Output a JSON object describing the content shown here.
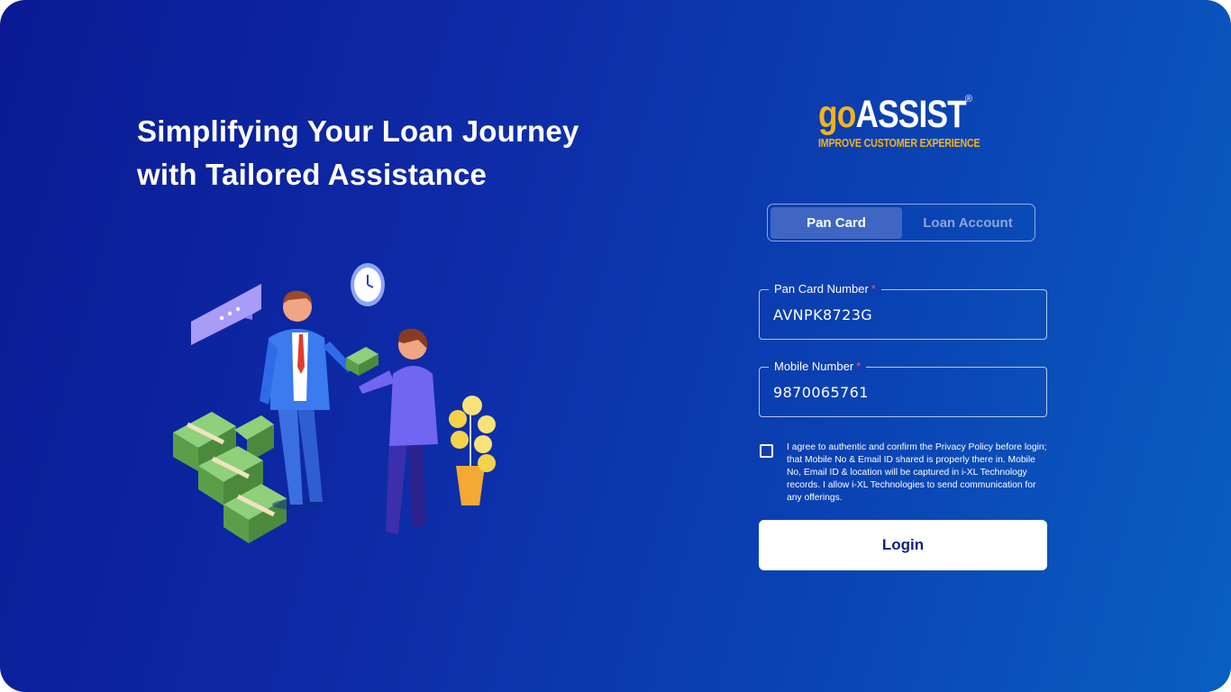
{
  "hero": {
    "title_line1": "Simplifying Your Loan Journey",
    "title_line2": "with Tailored Assistance"
  },
  "logo": {
    "brand_prefix": "go",
    "brand_main": "ASSIST",
    "registered_mark": "®",
    "tagline": "IMPROVE CUSTOMER EXPERIENCE"
  },
  "tabs": [
    {
      "label": "Pan Card",
      "active": true
    },
    {
      "label": "Loan Account",
      "active": false
    }
  ],
  "form": {
    "pan": {
      "label": "Pan Card Number",
      "required_mark": "*",
      "value": "AVNPK8723G"
    },
    "mobile": {
      "label": "Mobile Number",
      "required_mark": "*",
      "value": "9870065761"
    },
    "agreement": {
      "checked": false,
      "text": "I agree to authentic and confirm the Privacy Policy before login; that Mobile No & Email ID shared is properly there in. Mobile No, Email ID & location will be captured in i-XL Technology records. I allow i-XL Technologies to send communication for any offerings."
    },
    "login_label": "Login"
  },
  "colors": {
    "background_start": "#0b1a94",
    "background_end": "#0a5fc2",
    "brand_yellow": "#f4b21b",
    "active_tab": "#4066c4",
    "button_text": "#0d2480"
  }
}
